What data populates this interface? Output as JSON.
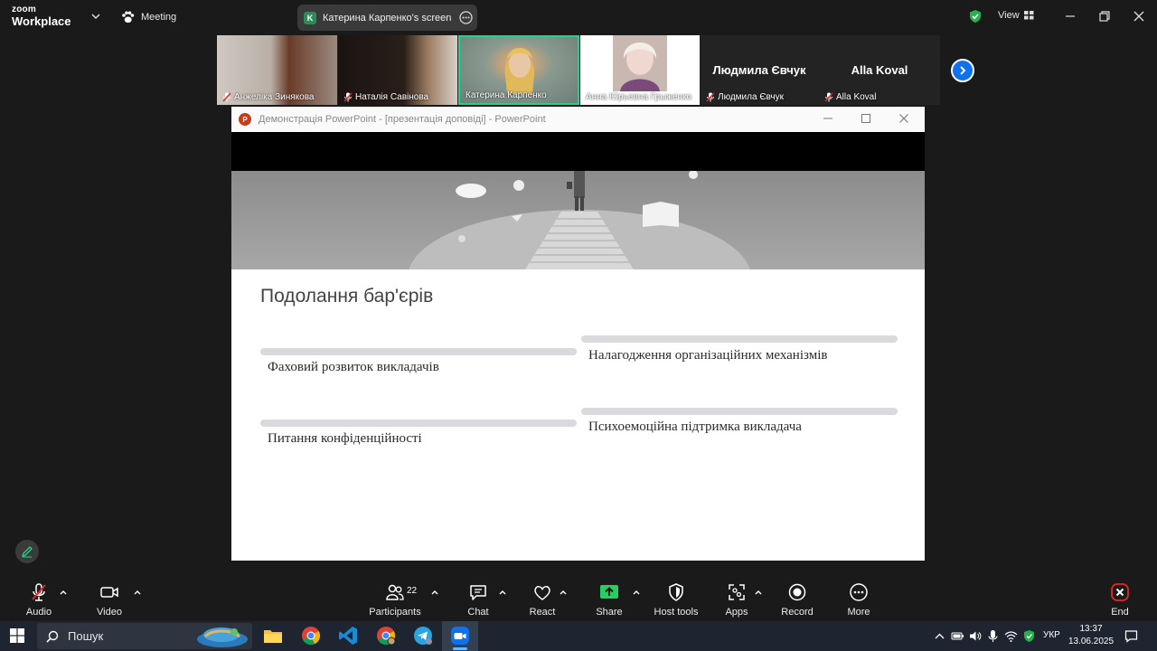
{
  "app": {
    "logo_line1": "zoom",
    "logo_line2": "Workplace"
  },
  "topbar": {
    "meeting_label": "Meeting",
    "sharing_initial": "K",
    "sharing_label": "Катерина Карпенко's screen",
    "view_label": "View"
  },
  "participants": [
    {
      "name": "Анжеліка Зинякова",
      "muted": true
    },
    {
      "name": "Наталія Савінова",
      "muted": true
    },
    {
      "name": "Катерина Карпенко",
      "muted": false,
      "active": true
    },
    {
      "name": "Анна Юрьевна Грыженко",
      "muted": false
    },
    {
      "name": "Людмила Євчук",
      "display": "Людмила Євчук",
      "muted": true
    },
    {
      "name": "Alla Koval",
      "display": "Alla Koval",
      "muted": true
    }
  ],
  "ppt": {
    "window_title": "Демонстрація PowerPoint - [презентація доповіді] - PowerPoint",
    "app_initial": "P",
    "slide_title": "Подолання бар'єрів",
    "items": [
      "Фаховий розвиток викладачів",
      "Налагодження організаційних механізмів",
      "Питання конфіденційності",
      "Психоемоційна підтримка викладача"
    ]
  },
  "toolbar": {
    "audio": "Audio",
    "video": "Video",
    "participants": "Participants",
    "participants_count": "22",
    "chat": "Chat",
    "react": "React",
    "share": "Share",
    "host_tools": "Host tools",
    "apps": "Apps",
    "record": "Record",
    "more": "More",
    "end": "End"
  },
  "taskbar": {
    "search_placeholder": "Пошук",
    "language": "УКР",
    "time": "13:37",
    "date": "13.06.2025"
  },
  "colors": {
    "accent_blue": "#0e72ed",
    "active_green": "#23d18b",
    "share_green": "#23d160",
    "end_red": "#e02828",
    "shield_green": "#23b24d"
  }
}
